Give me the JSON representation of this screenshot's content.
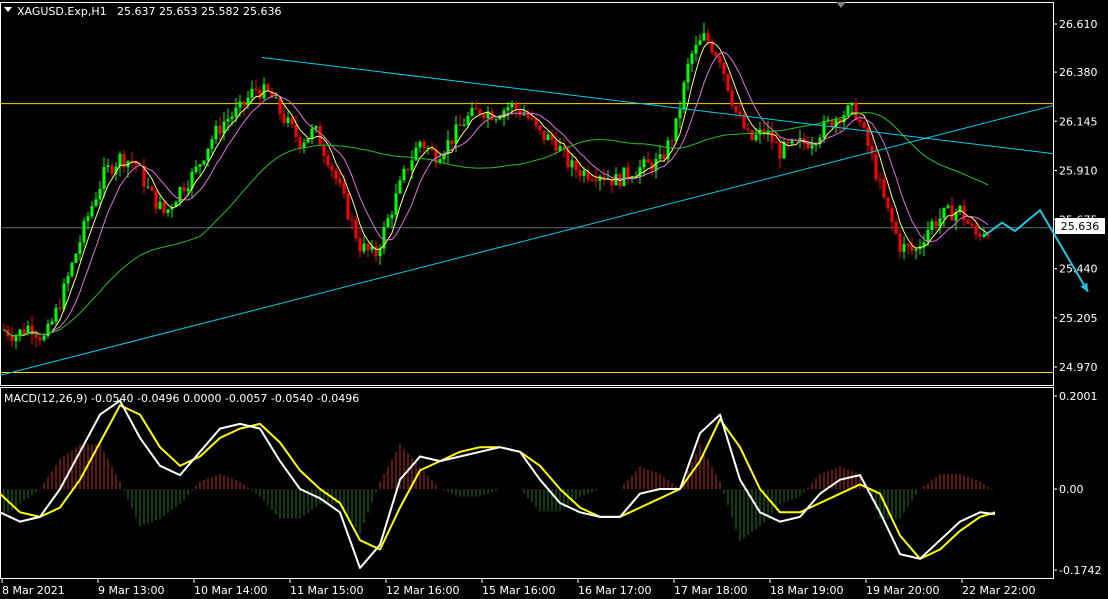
{
  "header": {
    "symbol_label": "XAGUSD.Exp,H1",
    "ohlc_label": "25.637 25.653 25.582 25.636"
  },
  "price_tag": "25.636",
  "colors": {
    "background": "#000000",
    "grid_border": "#ffffff",
    "bull_candle": "#00ff00",
    "bear_candle": "#ff0000",
    "trend_lines": "#00cfe8",
    "horizontal_levels": "#ffd700",
    "ma_fast": "#ffff66",
    "ma_mid": "#e070e0",
    "ma_slow": "#22c022",
    "macd_line": "#ffffff",
    "signal_line": "#ffff00",
    "hist_pos": "#c62a1f",
    "hist_neg": "#207a20",
    "forecast_arrow": "#1ec8e0"
  },
  "chart_data": [
    {
      "type": "candlestick",
      "title": "XAGUSD.Exp,H1",
      "ylim": [
        24.9,
        26.7
      ],
      "y_ticks": [
        "26.610",
        "26.380",
        "26.145",
        "25.910",
        "25.675",
        "25.440",
        "25.205",
        "24.970"
      ],
      "y_tick_values": [
        26.61,
        26.38,
        26.145,
        25.91,
        25.675,
        25.44,
        25.205,
        24.97
      ],
      "x_ticks": [
        "8 Mar 2021",
        "9 Mar 13:00",
        "10 Mar 14:00",
        "11 Mar 15:00",
        "12 Mar 16:00",
        "15 Mar 16:00",
        "16 Mar 17:00",
        "17 Mar 18:00",
        "18 Mar 19:00",
        "19 Mar 20:00",
        "22 Mar 22:00"
      ],
      "last_price": 25.636,
      "horizontal_levels": [
        26.229,
        24.944
      ],
      "grey_level": 25.636,
      "price_path": [
        [
          0,
          25.16
        ],
        [
          15,
          25.12
        ],
        [
          30,
          25.17
        ],
        [
          45,
          25.1
        ],
        [
          60,
          25.28
        ],
        [
          75,
          25.5
        ],
        [
          90,
          25.72
        ],
        [
          105,
          25.9
        ],
        [
          120,
          25.97
        ],
        [
          135,
          25.95
        ],
        [
          150,
          25.8
        ],
        [
          165,
          25.7
        ],
        [
          180,
          25.82
        ],
        [
          195,
          25.9
        ],
        [
          210,
          26.05
        ],
        [
          225,
          26.15
        ],
        [
          240,
          26.2
        ],
        [
          255,
          26.3
        ],
        [
          270,
          26.27
        ],
        [
          285,
          26.15
        ],
        [
          300,
          26.05
        ],
        [
          315,
          26.1
        ],
        [
          330,
          25.95
        ],
        [
          345,
          25.75
        ],
        [
          360,
          25.55
        ],
        [
          375,
          25.5
        ],
        [
          390,
          25.7
        ],
        [
          405,
          25.9
        ],
        [
          420,
          26.05
        ],
        [
          435,
          25.98
        ],
        [
          450,
          26.05
        ],
        [
          465,
          26.15
        ],
        [
          480,
          26.2
        ],
        [
          495,
          26.18
        ],
        [
          510,
          26.22
        ],
        [
          525,
          26.18
        ],
        [
          540,
          26.08
        ],
        [
          555,
          26.05
        ],
        [
          570,
          25.93
        ],
        [
          585,
          25.9
        ],
        [
          600,
          25.9
        ],
        [
          615,
          25.86
        ],
        [
          630,
          25.9
        ],
        [
          645,
          25.93
        ],
        [
          660,
          25.95
        ],
        [
          675,
          26.1
        ],
        [
          690,
          26.45
        ],
        [
          705,
          26.55
        ],
        [
          720,
          26.45
        ],
        [
          735,
          26.2
        ],
        [
          750,
          26.05
        ],
        [
          765,
          26.1
        ],
        [
          780,
          26.0
        ],
        [
          795,
          26.03
        ],
        [
          810,
          26.05
        ],
        [
          825,
          26.12
        ],
        [
          840,
          26.18
        ],
        [
          855,
          26.2
        ],
        [
          870,
          26.0
        ],
        [
          885,
          25.75
        ],
        [
          900,
          25.55
        ],
        [
          915,
          25.52
        ],
        [
          930,
          25.65
        ],
        [
          945,
          25.7
        ],
        [
          960,
          25.72
        ],
        [
          975,
          25.6
        ],
        [
          990,
          25.64
        ]
      ],
      "trend_lines": [
        {
          "from": [
            262,
            26.45
          ],
          "to": [
            1053,
            25.99
          ]
        },
        {
          "from": [
            0,
            24.93
          ],
          "to": [
            1053,
            26.22
          ]
        }
      ],
      "forecast_path": [
        [
          985,
          25.6
        ],
        [
          1002,
          25.66
        ],
        [
          1015,
          25.62
        ],
        [
          1040,
          25.72
        ],
        [
          1088,
          25.33
        ]
      ]
    },
    {
      "type": "line",
      "title": "MACD(12,26,9) -0.0540 -0.0496 0.0000 -0.0057 -0.0540 -0.0496",
      "ylim": [
        -0.1742,
        0.2001
      ],
      "y_ticks": [
        "0.2001",
        "0.00",
        "-0.1742"
      ],
      "y_tick_values": [
        0.2001,
        0.0,
        -0.1742
      ],
      "series": [
        {
          "name": "MACD",
          "x": [
            0,
            20,
            40,
            60,
            80,
            100,
            120,
            140,
            160,
            180,
            200,
            220,
            240,
            260,
            280,
            300,
            320,
            340,
            360,
            380,
            400,
            420,
            440,
            460,
            480,
            500,
            520,
            540,
            560,
            580,
            600,
            620,
            640,
            660,
            680,
            700,
            720,
            740,
            760,
            780,
            800,
            820,
            840,
            860,
            880,
            900,
            920,
            940,
            960,
            980,
            995
          ],
          "values": [
            -0.05,
            -0.07,
            -0.06,
            0.0,
            0.08,
            0.16,
            0.19,
            0.11,
            0.05,
            0.03,
            0.08,
            0.13,
            0.14,
            0.13,
            0.06,
            0.0,
            -0.02,
            -0.05,
            -0.17,
            -0.12,
            0.02,
            0.07,
            0.06,
            0.07,
            0.08,
            0.09,
            0.08,
            0.02,
            -0.03,
            -0.05,
            -0.06,
            -0.06,
            -0.01,
            0.0,
            0.0,
            0.12,
            0.16,
            0.02,
            -0.05,
            -0.07,
            -0.06,
            -0.01,
            0.02,
            0.03,
            -0.05,
            -0.14,
            -0.15,
            -0.11,
            -0.07,
            -0.05,
            -0.054
          ]
        },
        {
          "name": "Signal",
          "x": [
            0,
            20,
            40,
            60,
            80,
            100,
            120,
            140,
            160,
            180,
            200,
            220,
            240,
            260,
            280,
            300,
            320,
            340,
            360,
            380,
            400,
            420,
            440,
            460,
            480,
            500,
            520,
            540,
            560,
            580,
            600,
            620,
            640,
            660,
            680,
            700,
            720,
            740,
            760,
            780,
            800,
            820,
            840,
            860,
            880,
            900,
            920,
            940,
            960,
            980,
            995
          ],
          "values": [
            -0.01,
            -0.05,
            -0.06,
            -0.04,
            0.02,
            0.1,
            0.18,
            0.16,
            0.09,
            0.05,
            0.07,
            0.11,
            0.13,
            0.14,
            0.1,
            0.04,
            0.0,
            -0.03,
            -0.11,
            -0.13,
            -0.04,
            0.04,
            0.06,
            0.08,
            0.09,
            0.09,
            0.08,
            0.05,
            0.0,
            -0.04,
            -0.06,
            -0.06,
            -0.04,
            -0.02,
            0.0,
            0.06,
            0.15,
            0.09,
            0.0,
            -0.05,
            -0.05,
            -0.03,
            -0.01,
            0.01,
            -0.01,
            -0.1,
            -0.15,
            -0.13,
            -0.09,
            -0.06,
            -0.05
          ]
        }
      ]
    }
  ]
}
